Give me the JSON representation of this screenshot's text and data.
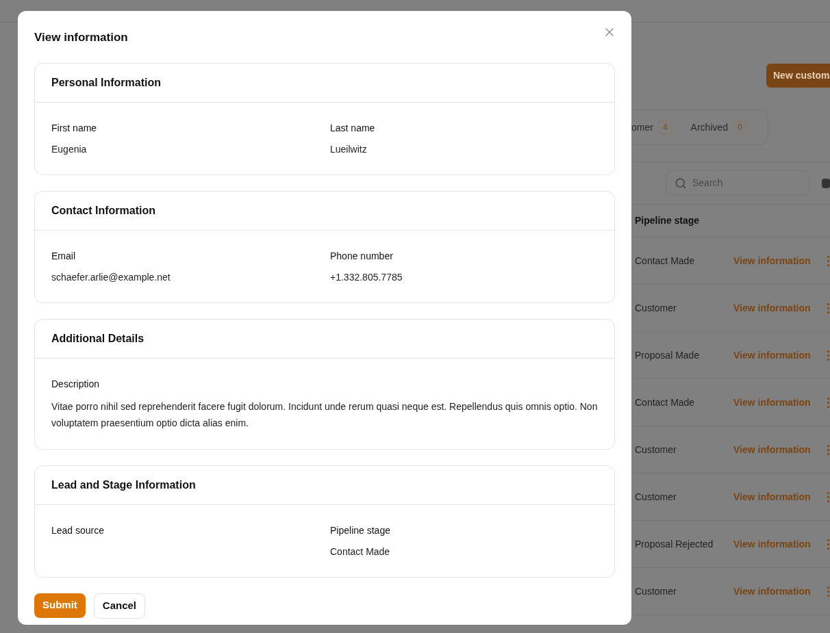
{
  "background": {
    "header_button": "New custom",
    "tabs": [
      {
        "label": "omer",
        "count": "4"
      },
      {
        "label": "Archived",
        "count": "0"
      }
    ],
    "search": {
      "placeholder": "Search"
    },
    "table": {
      "columns": [
        "Pipeline stage"
      ],
      "rows": [
        {
          "stage": "Contact Made",
          "action": "View information"
        },
        {
          "stage": "Customer",
          "action": "View information"
        },
        {
          "stage": "Proposal Made",
          "action": "View information"
        },
        {
          "stage": "Contact Made",
          "action": "View information"
        },
        {
          "stage": "Customer",
          "action": "View information"
        },
        {
          "stage": "Customer",
          "action": "View information"
        },
        {
          "stage": "Proposal Rejected",
          "action": "View information"
        },
        {
          "stage": "Customer",
          "action": "View information"
        }
      ]
    }
  },
  "dialog": {
    "title": "View information",
    "sections": [
      {
        "title": "Personal Information",
        "fields": [
          {
            "kind": "pair",
            "label": "First name",
            "value": "Eugenia"
          },
          {
            "kind": "pair",
            "label": "Last name",
            "value": "Lueilwitz"
          }
        ]
      },
      {
        "title": "Contact Information",
        "fields": [
          {
            "kind": "pair",
            "label": "Email",
            "value": "schaefer.arlie@example.net"
          },
          {
            "kind": "pair",
            "label": "Phone number",
            "value": "+1.332.805.7785"
          }
        ]
      },
      {
        "title": "Additional Details",
        "fields": [
          {
            "kind": "wide",
            "label": "Description",
            "value": "Vitae porro nihil sed reprehenderit facere fugit dolorum. Incidunt unde rerum quasi neque est. Repellendus quis omnis optio. Non voluptatem praesentium optio dicta alias enim."
          }
        ]
      },
      {
        "title": "Lead and Stage Information",
        "fields": [
          {
            "kind": "pair",
            "label": "Lead source"
          },
          {
            "kind": "pair",
            "label": "Pipeline stage",
            "value": "Contact Made"
          }
        ]
      }
    ],
    "buttons": [
      {
        "label": "Submit",
        "kind": "primary"
      },
      {
        "label": "Cancel",
        "kind": "secondary"
      }
    ]
  }
}
